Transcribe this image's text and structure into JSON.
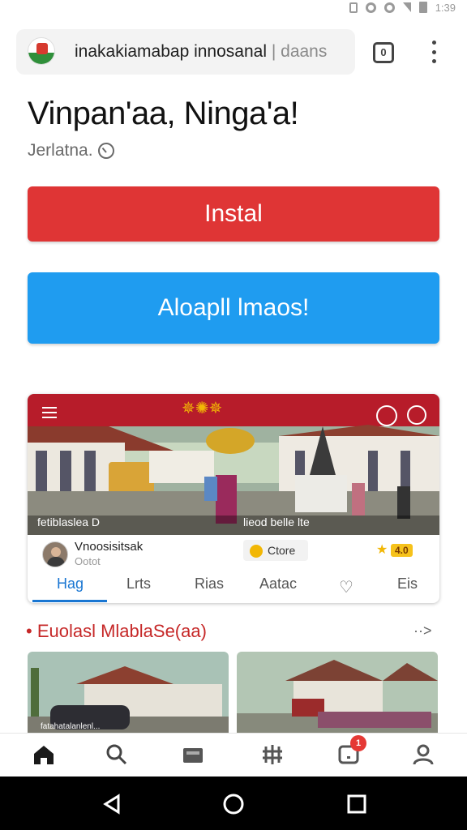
{
  "status_bar": {
    "time": "1:39"
  },
  "browser": {
    "url_main": "inakakiamabap innosanal",
    "url_muted": "| daans",
    "tabs_count": "0",
    "menu_icon": "more-vert-icon",
    "site_icon": "site-logo-icon"
  },
  "page": {
    "headline": "Vinpan'aa, Ninga'a!",
    "subline": "Jerlatna.",
    "install_label": "Instal",
    "alt_button_label": "Aloapll lmaos!",
    "colors": {
      "install": "#df3535",
      "alt": "#1f9cf0",
      "section": "#c62828",
      "tab_active": "#1976d2"
    }
  },
  "preview": {
    "hero_caption_left": "fetiblaslea D",
    "hero_caption_right": "lieod belle lte",
    "app_name": "Vnoosisitsak",
    "app_meta": "Ootot",
    "store_label": "Ctore",
    "rating_value": "4.0",
    "tabs": [
      "Hag",
      "Lrts",
      "Rias",
      "Aatac",
      "Eis"
    ]
  },
  "section": {
    "title": "• Euolasl MlablaSe(aa)",
    "more": "··>",
    "thumb1_caption": "fatahatalanlenl..."
  },
  "bottom_nav": {
    "items": [
      "home-icon",
      "search-icon",
      "wallet-icon",
      "grid-icon",
      "notification-icon",
      "profile-icon"
    ],
    "badge": "1"
  }
}
